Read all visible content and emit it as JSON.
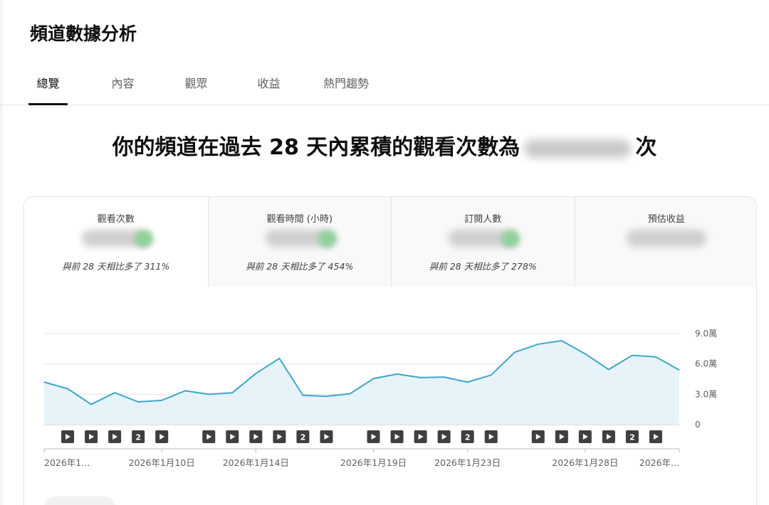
{
  "page_title": "頻道數據分析",
  "tabs": [
    {
      "label": "總覽",
      "active": true
    },
    {
      "label": "內容",
      "active": false
    },
    {
      "label": "觀眾",
      "active": false
    },
    {
      "label": "收益",
      "active": false
    },
    {
      "label": "熱門趨勢",
      "active": false
    }
  ],
  "headline": {
    "prefix": "你的頻道在過去 28 天內累積的觀看次數為",
    "suffix": "次"
  },
  "metrics": [
    {
      "label": "觀看次數",
      "change": "與前 28 天相比多了 311%",
      "selected": true
    },
    {
      "label": "觀看時間 (小時)",
      "change": "與前 28 天相比多了 454%",
      "selected": false
    },
    {
      "label": "訂閱人數",
      "change": "與前 28 天相比多了 278%",
      "selected": false
    },
    {
      "label": "預估收益",
      "change": "",
      "selected": false
    }
  ],
  "colors": {
    "line": "#3ea6c9",
    "area": "#e6f3f9",
    "marker": "#3f3f3f",
    "accent_green": "#8fd19a"
  },
  "chart_data": {
    "type": "area",
    "title": "",
    "xlabel": "",
    "ylabel": "",
    "ylim": [
      0,
      90000
    ],
    "y_ticks": [
      {
        "value": 90000,
        "label": "9.0萬"
      },
      {
        "value": 60000,
        "label": "6.0萬"
      },
      {
        "value": 30000,
        "label": "3.0萬"
      },
      {
        "value": 0,
        "label": "0"
      }
    ],
    "x_tick_labels": [
      {
        "day": 0,
        "label": "2026年1..."
      },
      {
        "day": 5,
        "label": "2026年1月10日"
      },
      {
        "day": 9,
        "label": "2026年1月14日"
      },
      {
        "day": 14,
        "label": "2026年1月19日"
      },
      {
        "day": 18,
        "label": "2026年1月23日"
      },
      {
        "day": 23,
        "label": "2026年1月28日"
      },
      {
        "day": 27,
        "label": "2026年..."
      }
    ],
    "series": [
      {
        "values": [
          42000,
          35500,
          20000,
          31500,
          22500,
          24000,
          33500,
          30000,
          31500,
          50500,
          65500,
          29000,
          28000,
          30500,
          45500,
          50000,
          46500,
          47000,
          42000,
          49000,
          71500,
          79500,
          83000,
          70000,
          54500,
          68500,
          67000,
          54000
        ]
      }
    ],
    "upload_markers": [
      {
        "day": 1,
        "mark": "play"
      },
      {
        "day": 2,
        "mark": "play"
      },
      {
        "day": 3,
        "mark": "play"
      },
      {
        "day": 4,
        "mark": "2"
      },
      {
        "day": 5,
        "mark": "play"
      },
      {
        "day": 7,
        "mark": "play"
      },
      {
        "day": 8,
        "mark": "play"
      },
      {
        "day": 9,
        "mark": "play"
      },
      {
        "day": 10,
        "mark": "play"
      },
      {
        "day": 11,
        "mark": "2"
      },
      {
        "day": 12,
        "mark": "play"
      },
      {
        "day": 14,
        "mark": "play"
      },
      {
        "day": 15,
        "mark": "play"
      },
      {
        "day": 16,
        "mark": "play"
      },
      {
        "day": 17,
        "mark": "play"
      },
      {
        "day": 18,
        "mark": "2"
      },
      {
        "day": 19,
        "mark": "play"
      },
      {
        "day": 21,
        "mark": "play"
      },
      {
        "day": 22,
        "mark": "play"
      },
      {
        "day": 23,
        "mark": "play"
      },
      {
        "day": 24,
        "mark": "play"
      },
      {
        "day": 25,
        "mark": "2"
      },
      {
        "day": 26,
        "mark": "play"
      }
    ],
    "grid": true
  }
}
